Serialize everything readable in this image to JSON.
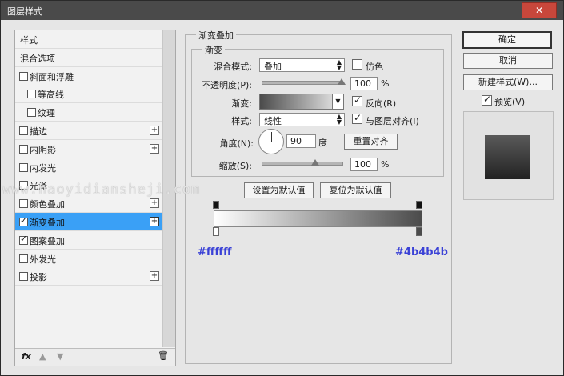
{
  "window": {
    "title": "图层样式",
    "close_label": "✕"
  },
  "left_panel": {
    "items": [
      {
        "label": "样式",
        "checkbox": false,
        "checked": false,
        "plus": false,
        "selected": false,
        "indent": false
      },
      {
        "label": "混合选项",
        "checkbox": false,
        "checked": false,
        "plus": false,
        "selected": false,
        "indent": false
      },
      {
        "label": "斜面和浮雕",
        "checkbox": true,
        "checked": false,
        "plus": false,
        "selected": false,
        "indent": false
      },
      {
        "label": "等高线",
        "checkbox": true,
        "checked": false,
        "plus": false,
        "selected": false,
        "indent": true
      },
      {
        "label": "纹理",
        "checkbox": true,
        "checked": false,
        "plus": false,
        "selected": false,
        "indent": true
      },
      {
        "label": "描边",
        "checkbox": true,
        "checked": false,
        "plus": true,
        "selected": false,
        "indent": false
      },
      {
        "label": "内阴影",
        "checkbox": true,
        "checked": false,
        "plus": true,
        "selected": false,
        "indent": false
      },
      {
        "label": "内发光",
        "checkbox": true,
        "checked": false,
        "plus": false,
        "selected": false,
        "indent": false
      },
      {
        "label": "光泽",
        "checkbox": true,
        "checked": false,
        "plus": false,
        "selected": false,
        "indent": false
      },
      {
        "label": "颜色叠加",
        "checkbox": true,
        "checked": false,
        "plus": true,
        "selected": false,
        "indent": false
      },
      {
        "label": "渐变叠加",
        "checkbox": true,
        "checked": true,
        "plus": true,
        "selected": true,
        "indent": false
      },
      {
        "label": "图案叠加",
        "checkbox": true,
        "checked": true,
        "plus": false,
        "selected": false,
        "indent": false
      },
      {
        "label": "外发光",
        "checkbox": true,
        "checked": false,
        "plus": false,
        "selected": false,
        "indent": false
      },
      {
        "label": "投影",
        "checkbox": true,
        "checked": false,
        "plus": true,
        "selected": false,
        "indent": false
      }
    ],
    "plus_label": "+",
    "footer": {
      "fx_label": "fx",
      "up_icon": "▲",
      "down_icon": "▼",
      "trash_icon": "🗑"
    }
  },
  "gradient_overlay": {
    "section_title": "渐变叠加",
    "group_title": "渐变",
    "blend_mode": {
      "label": "混合模式:",
      "value": "叠加"
    },
    "dither": {
      "label": "仿色",
      "checked": false
    },
    "opacity": {
      "label": "不透明度(P):",
      "value": "100",
      "unit": "%",
      "level": 100
    },
    "gradient": {
      "label": "渐变:"
    },
    "reverse": {
      "label": "反向(R)",
      "checked": true
    },
    "style": {
      "label": "样式:",
      "value": "线性"
    },
    "align": {
      "label": "与图层对齐(I)",
      "checked": true
    },
    "angle": {
      "label": "角度(N):",
      "value": "90",
      "unit": "度"
    },
    "reset_align": "重置对齐",
    "scale": {
      "label": "缩放(S):",
      "value": "100",
      "unit": "%",
      "level": 100
    },
    "set_default": "设置为默认值",
    "reset_default": "复位为默认值"
  },
  "gradient_editor": {
    "left_color": "#ffffff",
    "right_color": "#4b4b4b",
    "left_hex": "#ffffff",
    "right_hex": "#4b4b4b"
  },
  "buttons": {
    "ok": "确定",
    "cancel": "取消",
    "new_style": "新建样式(W)...",
    "preview_label": "预览(V)",
    "preview_checked": true
  },
  "watermark": "www.haoyidiansheji.com"
}
